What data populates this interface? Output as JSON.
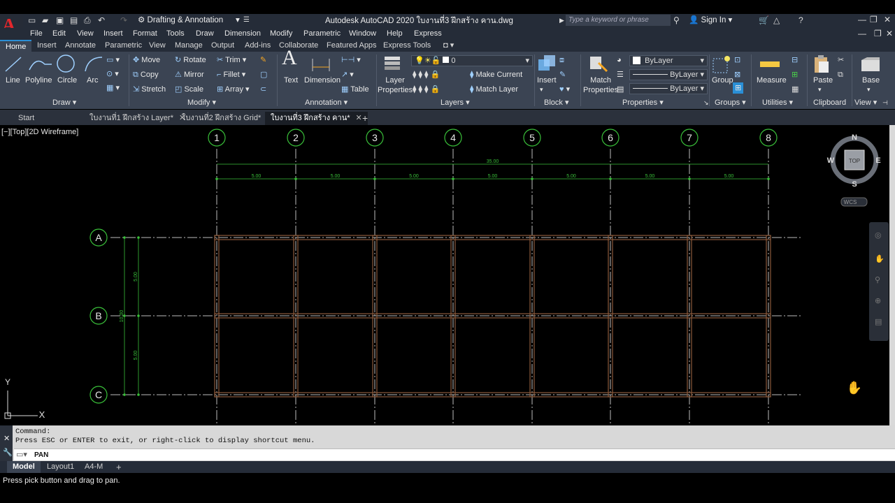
{
  "app": {
    "title": "Autodesk AutoCAD 2020    ใบงานที่3 ฝึกสร้าง คาน.dwg",
    "workspace": "Drafting & Annotation",
    "search_placeholder": "Type a keyword or phrase",
    "sign_in": "Sign In"
  },
  "menu": [
    "File",
    "Edit",
    "View",
    "Insert",
    "Format",
    "Tools",
    "Draw",
    "Dimension",
    "Modify",
    "Parametric",
    "Window",
    "Help",
    "Express"
  ],
  "ribbon_tabs": [
    "Home",
    "Insert",
    "Annotate",
    "Parametric",
    "View",
    "Manage",
    "Output",
    "Add-ins",
    "Collaborate",
    "Featured Apps",
    "Express Tools"
  ],
  "ribbon": {
    "draw": {
      "title": "Draw",
      "line": "Line",
      "polyline": "Polyline",
      "circle": "Circle",
      "arc": "Arc"
    },
    "modify": {
      "title": "Modify",
      "move": "Move",
      "rotate": "Rotate",
      "trim": "Trim",
      "copy": "Copy",
      "mirror": "Mirror",
      "fillet": "Fillet",
      "stretch": "Stretch",
      "scale": "Scale",
      "array": "Array"
    },
    "annotation": {
      "title": "Annotation",
      "text": "Text",
      "dimension": "Dimension",
      "table": "Table"
    },
    "layers": {
      "title": "Layers",
      "layer_properties_1": "Layer",
      "layer_properties_2": "Properties",
      "current_layer": "0",
      "make_current": "Make Current",
      "match_layer": "Match Layer"
    },
    "block": {
      "title": "Block",
      "insert": "Insert"
    },
    "properties": {
      "title": "Properties",
      "match_1": "Match",
      "match_2": "Properties",
      "color": "ByLayer",
      "linetype": "ByLayer",
      "lineweight": "ByLayer"
    },
    "groups": {
      "title": "Groups",
      "group": "Group"
    },
    "utilities": {
      "title": "Utilities",
      "measure": "Measure"
    },
    "clipboard": {
      "title": "Clipboard",
      "paste": "Paste"
    },
    "view": {
      "title": "View",
      "base": "Base"
    }
  },
  "doc_tabs": [
    "Start",
    "ใบงานที่1 ฝึกสร้าง Layer*",
    "ใบงานที่2 ฝึกสร้าง Grid*",
    "ใบงานที่3 ฝึกสร้าง คาน*"
  ],
  "viewport": {
    "label": "[−][Top][2D Wireframe]",
    "grid_columns": [
      "1",
      "2",
      "3",
      "4",
      "5",
      "6",
      "7",
      "8"
    ],
    "grid_rows": [
      "A",
      "B",
      "C"
    ],
    "overall_dim": "35.00",
    "bay_dim": "5.00",
    "left_overall_dim": "10.00",
    "left_bay_dim": "5.00",
    "viewcube": {
      "n": "N",
      "s": "S",
      "e": "E",
      "w": "W",
      "top": "TOP",
      "wcs": "WCS"
    },
    "ucs": {
      "x": "X",
      "y": "Y"
    }
  },
  "command": {
    "history_1": "Command:",
    "history_2": "Press ESC or ENTER to exit, or right-click to display shortcut menu.",
    "current": "PAN"
  },
  "layout_tabs": [
    "Model",
    "Layout1",
    "A4-M"
  ],
  "status": "Press pick button and drag to pan.",
  "colors": {
    "grid": "#3ac13a",
    "beam": "#8b5a3c",
    "ribbon": "#3b4453",
    "accent": "#2a8fd6"
  }
}
